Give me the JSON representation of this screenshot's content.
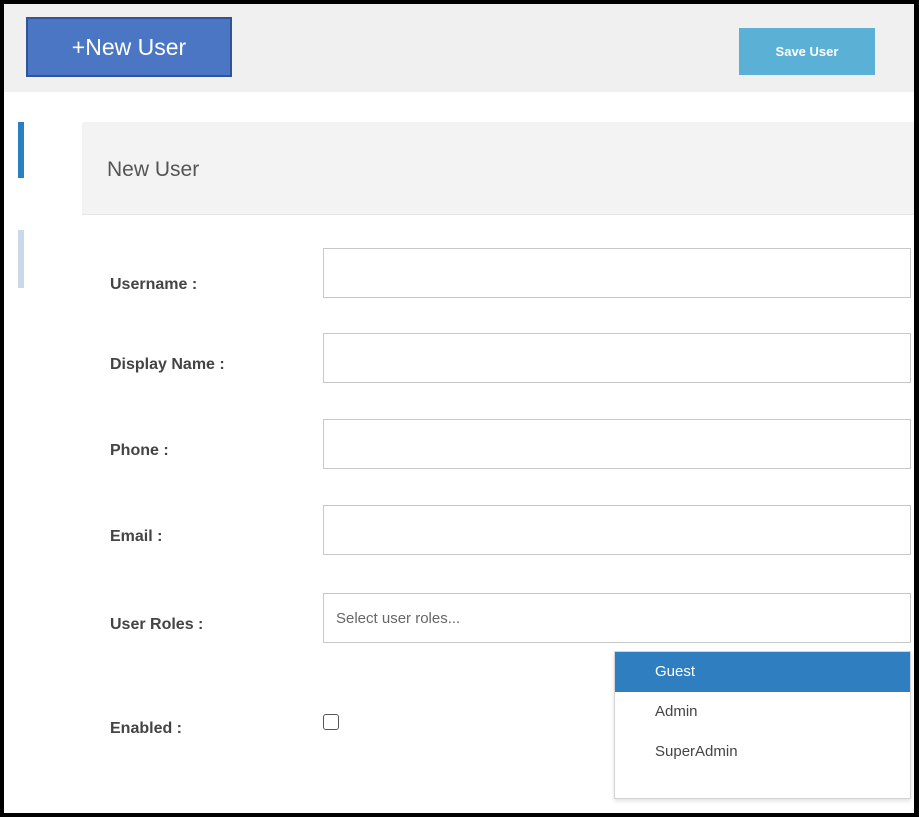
{
  "toolbar": {
    "new_user_label": "+New User",
    "save_user_label": "Save User"
  },
  "panel": {
    "title": "New User"
  },
  "form": {
    "fields": [
      {
        "label": "Username :",
        "value": ""
      },
      {
        "label": "Display Name :",
        "value": ""
      },
      {
        "label": "Phone :",
        "value": ""
      },
      {
        "label": "Email :",
        "value": ""
      }
    ],
    "roles": {
      "label": "User Roles :",
      "placeholder": "Select user roles...",
      "options": [
        "Guest",
        "Admin",
        "SuperAdmin"
      ],
      "highlighted_option": "Guest"
    },
    "enabled": {
      "label": "Enabled :",
      "checked": false
    }
  },
  "colors": {
    "new_user_button": "#4a76c4",
    "save_button": "#5bb0d6",
    "highlight": "#2f7fc0"
  }
}
